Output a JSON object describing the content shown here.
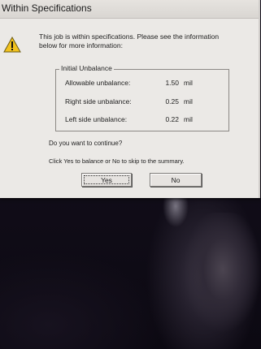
{
  "dialog": {
    "title": "Within Specifications",
    "message_line1": "This job is within specifications. Please see the information",
    "message_line2": "below for more information:",
    "group_title": "Initial Unbalance",
    "rows": [
      {
        "label": "Allowable unbalance:",
        "value": "1.50",
        "unit": "mil"
      },
      {
        "label": "Right side unbalance:",
        "value": "0.25",
        "unit": "mil"
      },
      {
        "label": "Left side unbalance:",
        "value": "0.22",
        "unit": "mil"
      }
    ],
    "question": "Do you want to continue?",
    "instruction": "Click Yes to balance or No to skip to the summary.",
    "yes_label": "Yes",
    "no_label": "No",
    "icon": "warning-icon"
  }
}
